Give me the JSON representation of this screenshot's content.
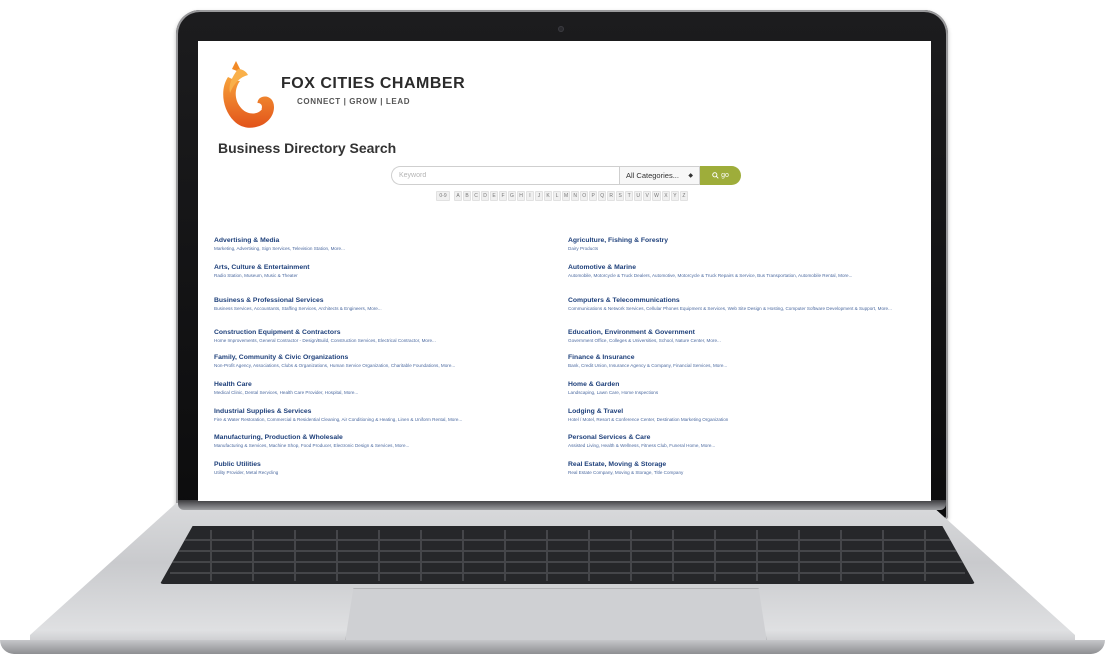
{
  "brand": {
    "name": "FOX CITIES CHAMBER",
    "tagline": "CONNECT | GROW | LEAD"
  },
  "page_title": "Business Directory Search",
  "search": {
    "placeholder": "Keyword",
    "category_selected": "All Categories...",
    "go_label": "go"
  },
  "letters": [
    "0-9",
    "A",
    "B",
    "C",
    "D",
    "E",
    "F",
    "G",
    "H",
    "I",
    "J",
    "K",
    "L",
    "M",
    "N",
    "O",
    "P",
    "Q",
    "R",
    "S",
    "T",
    "U",
    "V",
    "W",
    "X",
    "Y",
    "Z"
  ],
  "categories_left": [
    {
      "title": "Advertising & Media",
      "sub": "Marketing, Advertising, Sign Services, Television Station, More..."
    },
    {
      "title": "Arts, Culture & Entertainment",
      "sub": "Radio Station, Museum, Music & Theater"
    },
    {
      "title": "Business & Professional Services",
      "sub": "Business Services, Accountants, Staffing Services, Architects & Engineers, More..."
    },
    {
      "title": "Construction Equipment & Contractors",
      "sub": "Home Improvements, General Contractor - Design/Build, Construction Services, Electrical Contractor, More..."
    },
    {
      "title": "Family, Community & Civic Organizations",
      "sub": "Non-Profit Agency, Associations, Clubs & Organizations, Human Service Organization, Charitable Foundations, More..."
    },
    {
      "title": "Health Care",
      "sub": "Medical Clinic, Dental Services, Health Care Provider, Hospital, More..."
    },
    {
      "title": "Industrial Supplies & Services",
      "sub": "Fire & Water Restoration, Commercial & Residential Cleaning, Air Conditioning & Heating, Linen & Uniform Rental, More..."
    },
    {
      "title": "Manufacturing, Production & Wholesale",
      "sub": "Manufacturing & Services, Machine Shop, Food Producer, Electronic Design & Services, More..."
    },
    {
      "title": "Public Utilities",
      "sub": "Utility Provider, Metal Recycling"
    }
  ],
  "categories_right": [
    {
      "title": "Agriculture, Fishing & Forestry",
      "sub": "Dairy Products"
    },
    {
      "title": "Automotive & Marine",
      "sub": "Automobile, Motorcycle & Truck Dealers, Automotive, Motorcycle & Truck Repairs & Service, Bus Transportation, Automobile Rental, More..."
    },
    {
      "title": "Computers & Telecommunications",
      "sub": "Communications & Network Services, Cellular Phones Equipment & Services, Web Site Design & Hosting, Computer Software Development & Support, More..."
    },
    {
      "title": "Education, Environment & Government",
      "sub": "Government Office, Colleges & Universities, School, Nature Center, More..."
    },
    {
      "title": "Finance & Insurance",
      "sub": "Bank, Credit Union, Insurance Agency & Company, Financial Services, More..."
    },
    {
      "title": "Home & Garden",
      "sub": "Landscaping, Lawn Care, Home Inspections"
    },
    {
      "title": "Lodging & Travel",
      "sub": "Hotel / Motel, Resort & Conference Center, Destination Marketing Organization"
    },
    {
      "title": "Personal Services & Care",
      "sub": "Assisted Living, Health & Wellness, Fitness Club, Funeral Home, More..."
    },
    {
      "title": "Real Estate, Moving & Storage",
      "sub": "Real Estate Company, Moving & Storage, Title Company"
    }
  ],
  "colors": {
    "accent_go": "#9ead3a",
    "link": "#1d3f7a",
    "logo_orange": "#f07a1a"
  },
  "icons": [
    "fox-logo-icon",
    "search-icon",
    "select-arrow-icon"
  ]
}
